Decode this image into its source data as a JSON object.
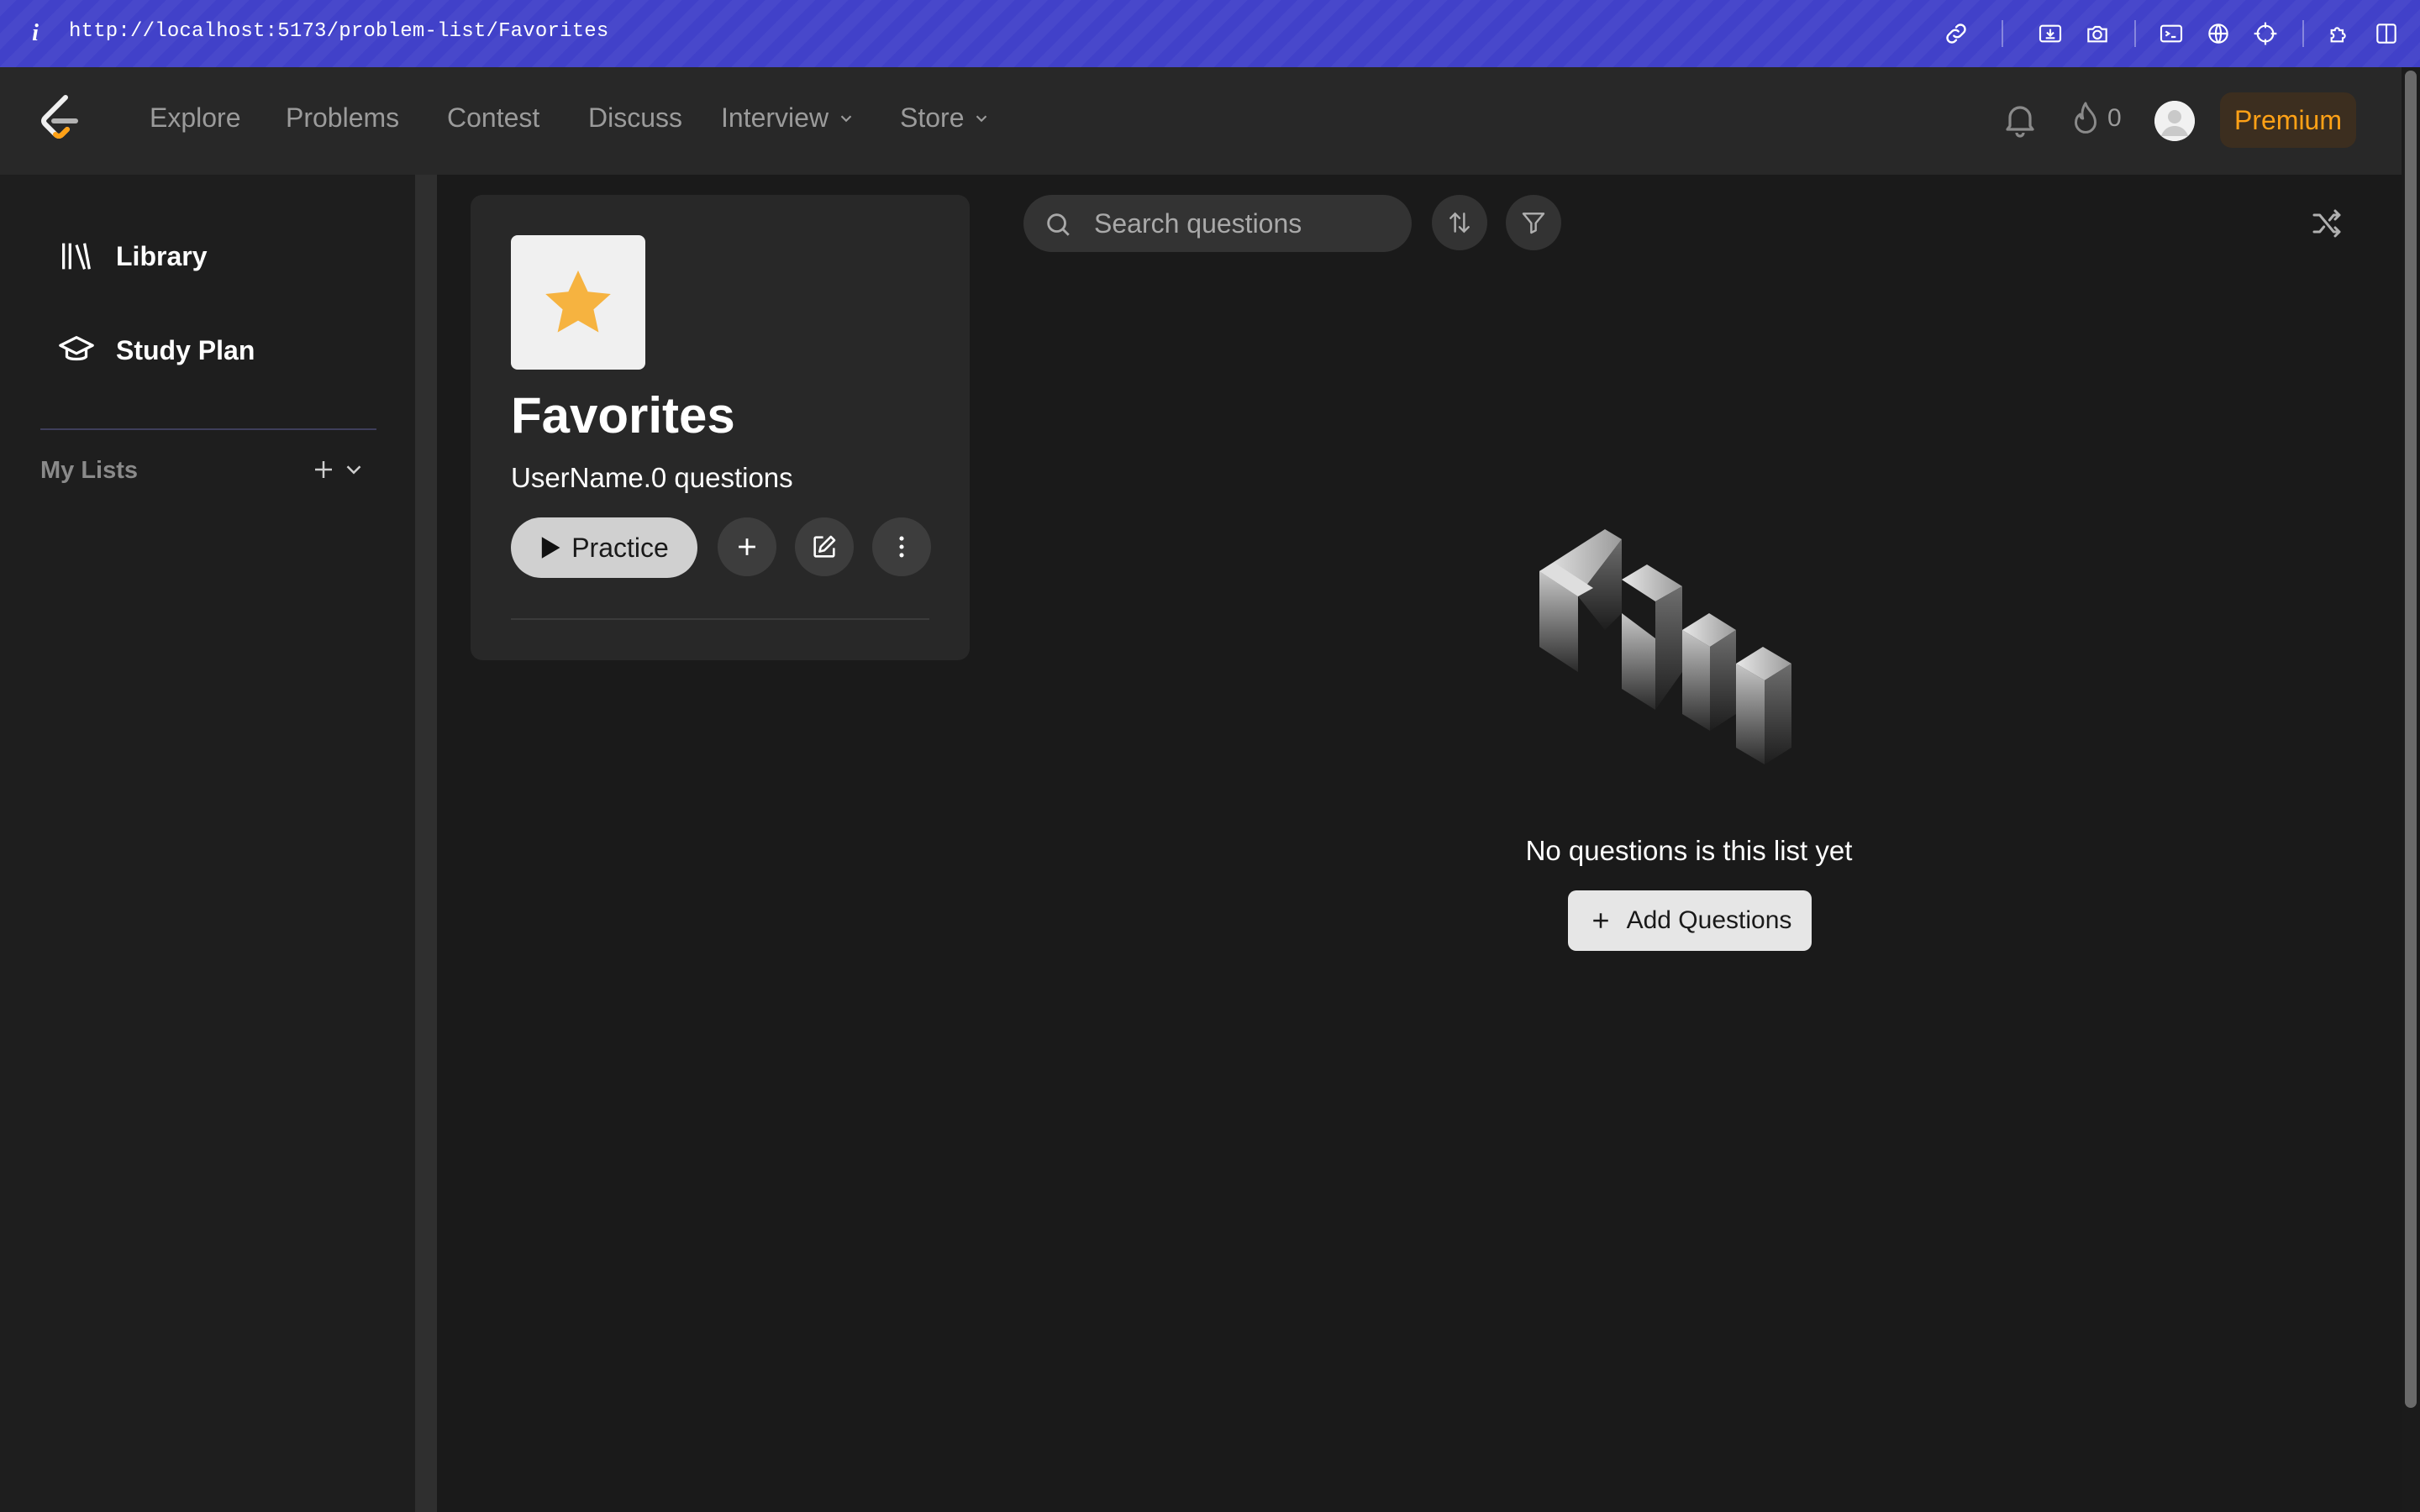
{
  "browser": {
    "url": "http://localhost:5173/problem-list/Favorites",
    "info_glyph": "i"
  },
  "nav": {
    "links": [
      "Explore",
      "Problems",
      "Contest",
      "Discuss",
      "Interview",
      "Store"
    ],
    "streak_count": "0",
    "premium_label": "Premium"
  },
  "sidebar": {
    "library_label": "Library",
    "study_plan_label": "Study Plan",
    "my_lists_label": "My Lists"
  },
  "favorites": {
    "title": "Favorites",
    "subtitle": "UserName.0 questions",
    "practice_label": "Practice"
  },
  "search": {
    "placeholder": "Search questions"
  },
  "empty_state": {
    "message": "No questions is this list yet",
    "add_button_label": "Add Questions",
    "art_word": "NULL"
  },
  "colors": {
    "browser_bar": "#4141c9",
    "accent_orange": "#ffa116",
    "star": "#f6b340",
    "page_bg": "#1a1a1a"
  },
  "icons": {
    "browser": [
      "link-icon",
      "download-screen-icon",
      "camera-icon",
      "terminal-icon",
      "globe-icon",
      "crosshair-icon",
      "puzzle-icon",
      "sidebar-toggle-icon"
    ],
    "nav": [
      "leetcode-logo-icon",
      "bell-icon",
      "flame-icon",
      "avatar-icon"
    ],
    "sidebar": [
      "books-icon",
      "graduation-cap-icon",
      "plus-icon",
      "chevron-down-icon"
    ],
    "card": [
      "star-icon",
      "play-icon",
      "plus-icon",
      "edit-icon",
      "more-vertical-icon"
    ],
    "toolbar": [
      "search-icon",
      "sort-icon",
      "filter-icon",
      "shuffle-icon"
    ]
  }
}
